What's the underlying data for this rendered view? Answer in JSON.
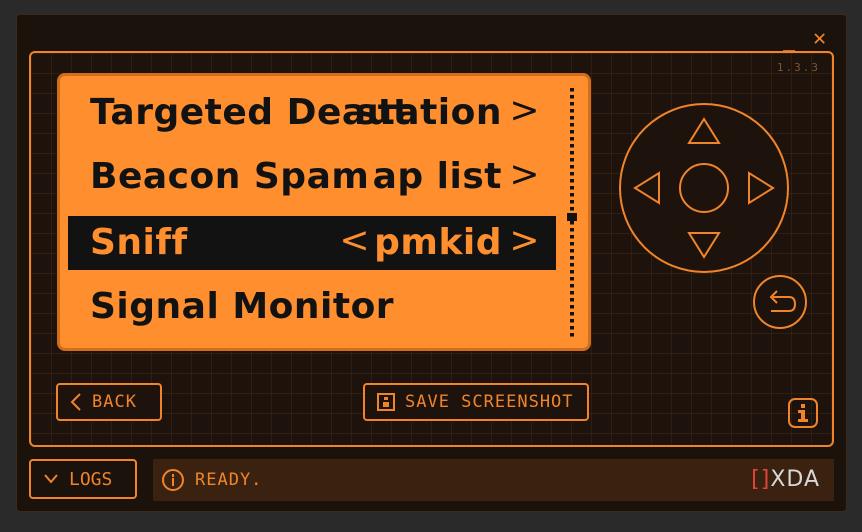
{
  "window": {
    "minimize_label": "_",
    "close_label": "✕"
  },
  "version": "1.3.3",
  "menu": {
    "items": [
      {
        "label": "Targeted Deaut",
        "value": "station",
        "arrow_right": ">"
      },
      {
        "label": "Beacon Spam",
        "value": "ap list",
        "arrow_right": ">"
      },
      {
        "label": "Sniff",
        "value": "pmkid",
        "arrow_left": "<",
        "arrow_right": ">"
      },
      {
        "label": "Signal Monitor"
      }
    ]
  },
  "buttons": {
    "back_label": "BACK",
    "save_screenshot_label": "SAVE SCREENSHOT",
    "logs_label": "LOGS"
  },
  "status": {
    "text": "READY."
  },
  "brand": {
    "bracket": "[]",
    "name": "XDA"
  },
  "colors": {
    "accent": "#f0842a",
    "screen": "#ff8f2e",
    "background": "#1a120b",
    "status_bar": "#3b2210"
  },
  "icons": [
    "minimize-icon",
    "close-icon",
    "up-arrow-icon",
    "down-arrow-icon",
    "left-arrow-icon",
    "right-arrow-icon",
    "return-icon",
    "info-icon",
    "chevron-left-icon",
    "screenshot-icon",
    "chevron-down-icon"
  ]
}
